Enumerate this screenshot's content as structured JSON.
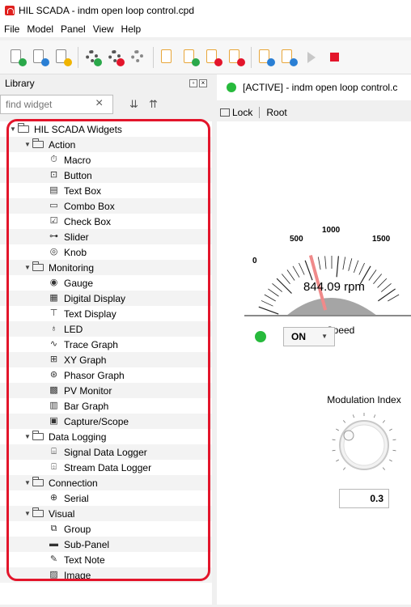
{
  "window": {
    "title": "HIL SCADA - indm open loop control.cpd"
  },
  "menu": [
    "File",
    "Model",
    "Panel",
    "View",
    "Help"
  ],
  "library": {
    "title": "Library",
    "search_placeholder": "find widget",
    "tree": [
      {
        "label": "HIL SCADA Widgets",
        "kind": "folder",
        "level": 0,
        "icon": "folder-icon"
      },
      {
        "label": "Action",
        "kind": "folder",
        "level": 1,
        "icon": "folder-icon"
      },
      {
        "label": "Macro",
        "kind": "item",
        "level": 2,
        "icon": "macro-icon"
      },
      {
        "label": "Button",
        "kind": "item",
        "level": 2,
        "icon": "button-icon"
      },
      {
        "label": "Text Box",
        "kind": "item",
        "level": 2,
        "icon": "text-box-icon"
      },
      {
        "label": "Combo Box",
        "kind": "item",
        "level": 2,
        "icon": "combo-box-icon"
      },
      {
        "label": "Check Box",
        "kind": "item",
        "level": 2,
        "icon": "check-box-icon"
      },
      {
        "label": "Slider",
        "kind": "item",
        "level": 2,
        "icon": "slider-icon"
      },
      {
        "label": "Knob",
        "kind": "item",
        "level": 2,
        "icon": "knob-icon"
      },
      {
        "label": "Monitoring",
        "kind": "folder",
        "level": 1,
        "icon": "folder-icon"
      },
      {
        "label": "Gauge",
        "kind": "item",
        "level": 2,
        "icon": "gauge-icon"
      },
      {
        "label": "Digital Display",
        "kind": "item",
        "level": 2,
        "icon": "digital-display-icon"
      },
      {
        "label": "Text Display",
        "kind": "item",
        "level": 2,
        "icon": "text-display-icon"
      },
      {
        "label": "LED",
        "kind": "item",
        "level": 2,
        "icon": "led-icon"
      },
      {
        "label": "Trace Graph",
        "kind": "item",
        "level": 2,
        "icon": "trace-graph-icon"
      },
      {
        "label": "XY Graph",
        "kind": "item",
        "level": 2,
        "icon": "xy-graph-icon"
      },
      {
        "label": "Phasor Graph",
        "kind": "item",
        "level": 2,
        "icon": "phasor-graph-icon"
      },
      {
        "label": "PV Monitor",
        "kind": "item",
        "level": 2,
        "icon": "pv-monitor-icon"
      },
      {
        "label": "Bar Graph",
        "kind": "item",
        "level": 2,
        "icon": "bar-graph-icon"
      },
      {
        "label": "Capture/Scope",
        "kind": "item",
        "level": 2,
        "icon": "capture-scope-icon"
      },
      {
        "label": "Data Logging",
        "kind": "folder",
        "level": 1,
        "icon": "folder-icon"
      },
      {
        "label": "Signal Data Logger",
        "kind": "item",
        "level": 2,
        "icon": "signal-data-logger-icon"
      },
      {
        "label": "Stream Data Logger",
        "kind": "item",
        "level": 2,
        "icon": "stream-data-logger-icon"
      },
      {
        "label": "Connection",
        "kind": "folder",
        "level": 1,
        "icon": "folder-icon"
      },
      {
        "label": "Serial",
        "kind": "item",
        "level": 2,
        "icon": "serial-icon"
      },
      {
        "label": "Visual",
        "kind": "folder",
        "level": 1,
        "icon": "folder-icon"
      },
      {
        "label": "Group",
        "kind": "item",
        "level": 2,
        "icon": "group-icon"
      },
      {
        "label": "Sub-Panel",
        "kind": "item",
        "level": 2,
        "icon": "sub-panel-icon"
      },
      {
        "label": "Text Note",
        "kind": "item",
        "level": 2,
        "icon": "text-note-icon"
      },
      {
        "label": "Image",
        "kind": "item",
        "level": 2,
        "icon": "image-icon"
      }
    ]
  },
  "canvas": {
    "tab_title": "[ACTIVE] - indm open loop control.c",
    "lock_label": "Lock",
    "root_label": "Root",
    "gauge": {
      "value_text": "844.09 rpm",
      "value": 844.09,
      "tick_labels": [
        "0",
        "500",
        "1000",
        "1500"
      ],
      "label": "Speed"
    },
    "led_color": "#27ba3c",
    "combo_value": "ON",
    "knob": {
      "label": "Modulation Index",
      "value": "0.3"
    }
  },
  "colors": {
    "accent_red": "#e3152b",
    "active_green": "#27ba3c",
    "needle": "#f08a8a"
  }
}
